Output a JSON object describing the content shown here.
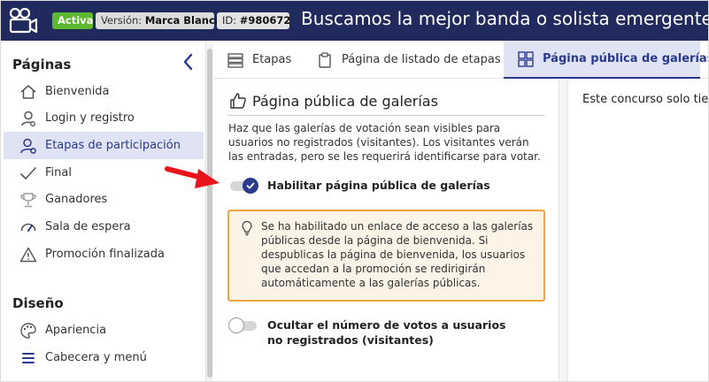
{
  "header": {
    "badge_active": "Activa",
    "badge_version_label": "Versión:",
    "badge_version_value": "Marca Blanca",
    "badge_id_label": "ID:",
    "badge_id_value": "#980672",
    "title": "Buscamos la mejor banda o solista emergente de"
  },
  "sidebar": {
    "section1": "Páginas",
    "items": [
      {
        "label": "Bienvenida",
        "icon": "home-icon"
      },
      {
        "label": "Login y registro",
        "icon": "user-icon"
      },
      {
        "label": "Etapas de participación",
        "icon": "user-settings-icon",
        "active": true
      },
      {
        "label": "Final",
        "icon": "check-icon"
      },
      {
        "label": "Ganadores",
        "icon": "trophy-icon"
      },
      {
        "label": "Sala de espera",
        "icon": "gauge-icon"
      },
      {
        "label": "Promoción finalizada",
        "icon": "warning-icon"
      }
    ],
    "section2": "Diseño",
    "items2": [
      {
        "label": "Apariencia",
        "icon": "palette-icon"
      },
      {
        "label": "Cabecera y menú",
        "icon": "menu-icon"
      }
    ]
  },
  "tabs": [
    {
      "label": "Etapas",
      "icon": "list-icon"
    },
    {
      "label": "Página de listado de etapas",
      "icon": "clipboard-icon"
    },
    {
      "label": "Página pública de galerías",
      "icon": "grid-icon",
      "active": true
    }
  ],
  "panel": {
    "title": "Página pública de galerías",
    "description": "Haz que las galerías de votación sean visibles para usuarios no registrados (visitantes). Los visitantes verán las entradas, pero se les requerirá identificarse para votar.",
    "toggle1_label": "Habilitar página pública de galerías",
    "toggle1_on": true,
    "notice": "Se ha habilitado un enlace de acceso a las galerías públicas desde la página de bienvenida. Si despublicas la página de bienvenida, los usuarios que accedan a la promoción se redirigirán automáticamente a las galerías públicas.",
    "toggle2_label": "Ocultar el número de votos a usuarios no registrados (visitantes)",
    "toggle2_on": false
  },
  "preview": {
    "text": "Este concurso solo tie"
  },
  "colors": {
    "header_bg": "#202a5c",
    "accent": "#2a3a8f",
    "active_badge": "#5cb82e",
    "notice_border": "#f0a540",
    "arrow": "#e8141b"
  }
}
